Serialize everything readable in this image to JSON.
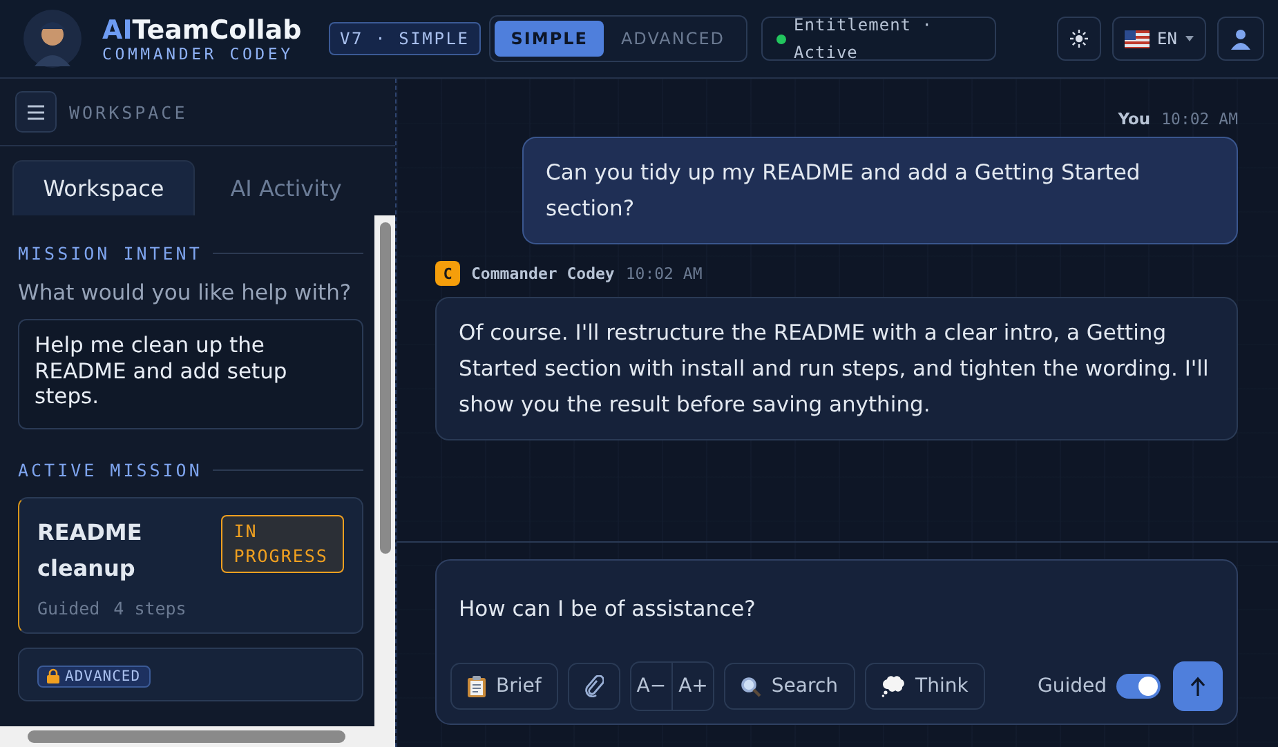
{
  "brand": {
    "title_accent": "AI",
    "title": "TeamCollab",
    "subtitle": "COMMANDER CODEY"
  },
  "version_badge": "V7 · SIMPLE",
  "mode_tabs": [
    {
      "label": "SIMPLE",
      "selected": true
    },
    {
      "label": "ADVANCED",
      "selected": false
    }
  ],
  "entitlement": {
    "label": "Entitlement · Active",
    "active": true
  },
  "language": {
    "code": "EN"
  },
  "sidebar": {
    "heading": "WORKSPACE",
    "tabs": [
      {
        "label": "Workspace",
        "selected": true
      },
      {
        "label": "AI Activity",
        "selected": false
      }
    ],
    "mission_intent": {
      "title": "MISSION INTENT",
      "question": "What would you like help with?",
      "value": "Help me clean up the README and add setup steps."
    },
    "active_mission": {
      "title": "ACTIVE MISSION",
      "card": {
        "title": "README cleanup",
        "status": "IN PROGRESS",
        "mode": "Guided",
        "steps": "4 steps"
      },
      "locked_card": {
        "badge": "ADVANCED",
        "locked": true
      }
    }
  },
  "messages": [
    {
      "kind": "user",
      "author": "You",
      "time": "10:02 AM",
      "text": "Can you tidy up my README and add a Getting Started section?"
    },
    {
      "kind": "assistant",
      "author": "Commander Codey",
      "avatar": "C",
      "time": "10:02 AM",
      "text": "Of course. I'll restructure the README with a clear intro, a Getting Started section with install and run steps, and tighten the wording. I'll show you the result before saving anything."
    }
  ],
  "composer": {
    "placeholder": "How can I be of assistance?",
    "brief_button": "Brief",
    "font_buttons": [
      "A−",
      "A+"
    ],
    "search_button": "Search",
    "think_button": "Think",
    "guided": {
      "label": "Guided",
      "on": true
    }
  }
}
